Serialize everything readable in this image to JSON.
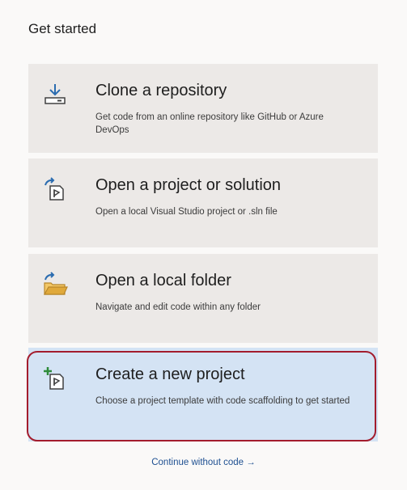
{
  "header": {
    "title": "Get started"
  },
  "actions": [
    {
      "title": "Clone a repository",
      "description": "Get code from an online repository like GitHub or Azure DevOps",
      "icon": "download-repository-icon"
    },
    {
      "title": "Open a project or solution",
      "description": "Open a local Visual Studio project or .sln file",
      "icon": "open-project-icon"
    },
    {
      "title": "Open a local folder",
      "description": "Navigate and edit code within any folder",
      "icon": "open-folder-icon"
    },
    {
      "title": "Create a new project",
      "description": "Choose a project template with code scaffolding to get started",
      "icon": "new-project-icon",
      "selected": true
    }
  ],
  "footer": {
    "continue_label": "Continue without code",
    "continue_arrow": "→"
  },
  "colors": {
    "background": "#faf9f8",
    "card": "#ece9e7",
    "card_selected": "#d4e3f4",
    "selection_ring": "#a31c2d",
    "link": "#1d4f91",
    "icon_blue": "#2b6cb0",
    "icon_green": "#2e8b3a",
    "folder_yellow": "#e0a93b"
  }
}
